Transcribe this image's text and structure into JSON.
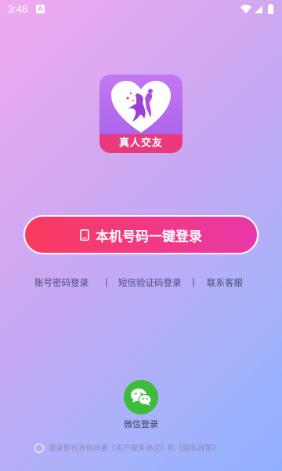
{
  "status_bar": {
    "time": "3:48",
    "notification_icon": "A"
  },
  "logo": {
    "label": "真人交友",
    "icon": "heart-couple-icon"
  },
  "primary_button": {
    "label": "本机号码一键登录",
    "icon": "phone-icon"
  },
  "links": {
    "account_login": "账号密码登录",
    "separator": "|",
    "sms_login": "短信验证码登录",
    "customer_service": "联系客服"
  },
  "wechat": {
    "label": "微信登录",
    "icon": "wechat-icon"
  },
  "agreement": {
    "text": "登录即代表你同意《用户服务协议》和《隐私政策》"
  },
  "colors": {
    "button_start": "#fb3a5d",
    "button_end": "#e838a6",
    "wechat_green": "#3dbb3a",
    "logo_banner": "#e93a7e"
  }
}
